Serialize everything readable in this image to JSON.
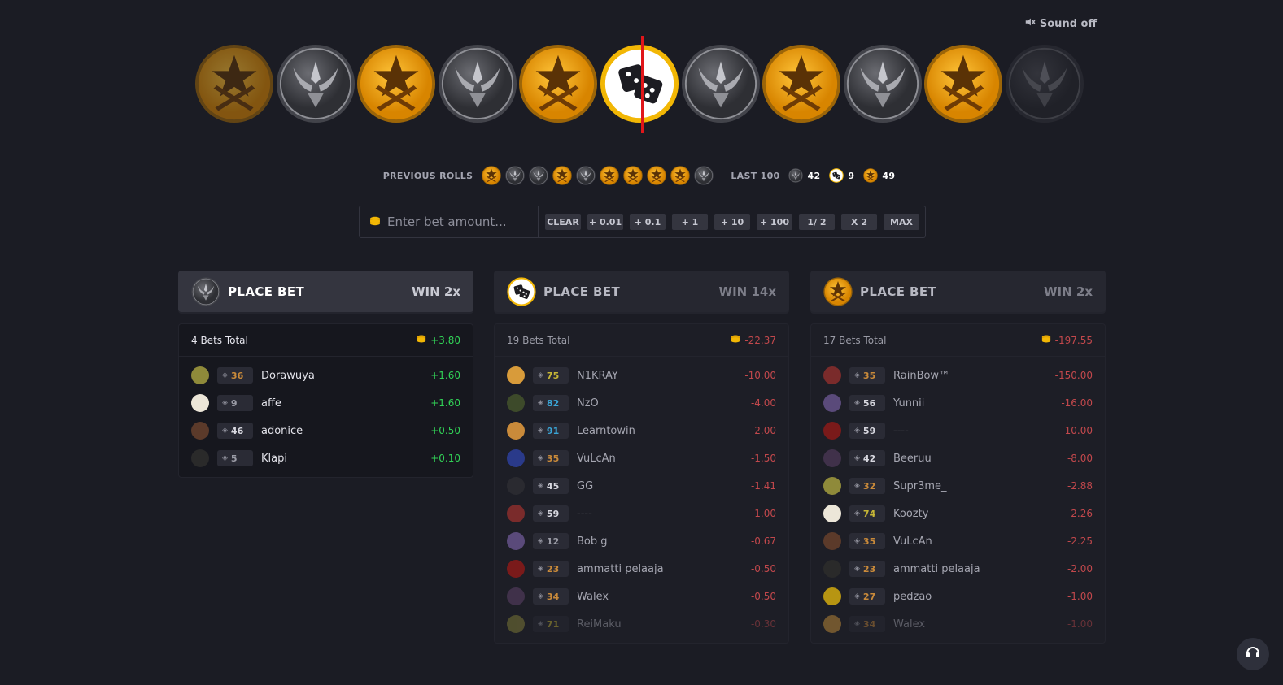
{
  "header": {
    "sound_label": "Sound off"
  },
  "colors": {
    "ct": "#8e8f95",
    "t": "#f0a20c",
    "dice": "#f2b705",
    "win": "#31d156",
    "loss": "#e04a4f",
    "marker": "#e0161a"
  },
  "roller": {
    "coins": [
      "t",
      "ct",
      "t",
      "ct",
      "t",
      "dice",
      "ct",
      "t",
      "ct",
      "t",
      "ct"
    ]
  },
  "previous": {
    "label": "PREVIOUS ROLLS",
    "rolls": [
      "t",
      "ct",
      "ct",
      "t",
      "ct",
      "t",
      "t",
      "t",
      "t",
      "ct"
    ],
    "last_label": "LAST 100",
    "last_ct": "42",
    "last_dice": "9",
    "last_t": "49"
  },
  "betbar": {
    "placeholder": "Enter bet amount...",
    "buttons": [
      "CLEAR",
      "+ 0.01",
      "+ 0.1",
      "+ 1",
      "+ 10",
      "+ 100",
      "1/ 2",
      "X 2",
      "MAX"
    ]
  },
  "columns": [
    {
      "key": "ct",
      "place_label": "PLACE BET",
      "win_label": "WIN 2x",
      "total_label": "4 Bets Total",
      "total_amount": "+3.80",
      "bets": [
        {
          "level": "36",
          "name": "Dorawuya",
          "amount": "+1.60"
        },
        {
          "level": "9",
          "name": "affe",
          "amount": "+1.60"
        },
        {
          "level": "46",
          "name": "adonice",
          "amount": "+0.50"
        },
        {
          "level": "5",
          "name": "Klapi",
          "amount": "+0.10"
        }
      ]
    },
    {
      "key": "dice",
      "place_label": "PLACE BET",
      "win_label": "WIN 14x",
      "total_label": "19 Bets Total",
      "total_amount": "-22.37",
      "bets": [
        {
          "level": "75",
          "name": "N1KRAY",
          "amount": "-10.00"
        },
        {
          "level": "82",
          "name": "NzO",
          "amount": "-4.00"
        },
        {
          "level": "91",
          "name": "Learntowin",
          "amount": "-2.00"
        },
        {
          "level": "35",
          "name": "VuLcAn",
          "amount": "-1.50"
        },
        {
          "level": "45",
          "name": "GG",
          "amount": "-1.41"
        },
        {
          "level": "59",
          "name": "----",
          "amount": "-1.00"
        },
        {
          "level": "12",
          "name": "Bob g",
          "amount": "-0.67"
        },
        {
          "level": "23",
          "name": "ammatti pelaaja",
          "amount": "-0.50"
        },
        {
          "level": "34",
          "name": "Walex",
          "amount": "-0.50"
        },
        {
          "level": "71",
          "name": "ReiMaku",
          "amount": "-0.30"
        }
      ]
    },
    {
      "key": "t",
      "place_label": "PLACE BET",
      "win_label": "WIN 2x",
      "total_label": "17 Bets Total",
      "total_amount": "-197.55",
      "bets": [
        {
          "level": "35",
          "name": "RainBow™",
          "amount": "-150.00"
        },
        {
          "level": "56",
          "name": "Yunnii",
          "amount": "-16.00"
        },
        {
          "level": "59",
          "name": "----",
          "amount": "-10.00"
        },
        {
          "level": "42",
          "name": "Beeruu",
          "amount": "-8.00"
        },
        {
          "level": "32",
          "name": "Supr3me_",
          "amount": "-2.88"
        },
        {
          "level": "74",
          "name": "Koozty",
          "amount": "-2.26"
        },
        {
          "level": "35",
          "name": "VuLcAn",
          "amount": "-2.25"
        },
        {
          "level": "23",
          "name": "ammatti pelaaja",
          "amount": "-2.00"
        },
        {
          "level": "27",
          "name": "pedzao",
          "amount": "-1.00"
        },
        {
          "level": "34",
          "name": "Walex",
          "amount": "-1.00"
        }
      ]
    }
  ]
}
